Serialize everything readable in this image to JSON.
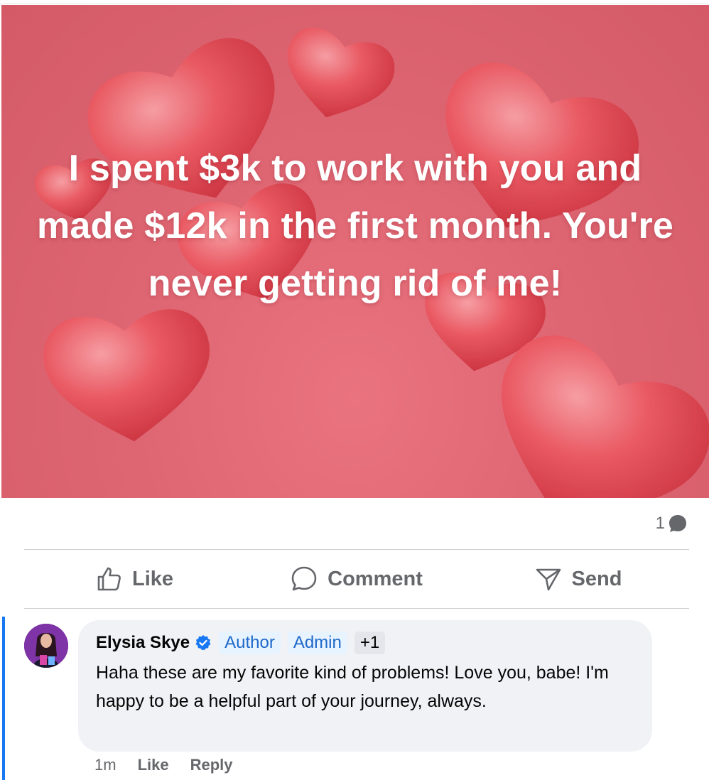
{
  "post": {
    "image_text": "I spent $3k to work with you and made $12k in the first month. You're never getting rid of me!",
    "background_color": "#de6672"
  },
  "stats": {
    "comment_count": "1",
    "comment_icon": "comment-bubble-icon"
  },
  "actions": [
    {
      "label": "Like",
      "icon": "thumbs-up-icon"
    },
    {
      "label": "Comment",
      "icon": "comment-icon"
    },
    {
      "label": "Send",
      "icon": "send-icon"
    }
  ],
  "comment": {
    "author": "Elysia Skye",
    "verified": true,
    "badges": [
      "Author",
      "Admin",
      "+1"
    ],
    "text": "Haha these are my favorite kind of problems! Love you, babe! I'm happy to be a helpful part of your journey, always.",
    "time": "1m",
    "like_label": "Like",
    "reply_label": "Reply"
  },
  "colors": {
    "accent": "#1877f2",
    "bubble": "#f0f2f5",
    "muted_text": "#65676b"
  }
}
